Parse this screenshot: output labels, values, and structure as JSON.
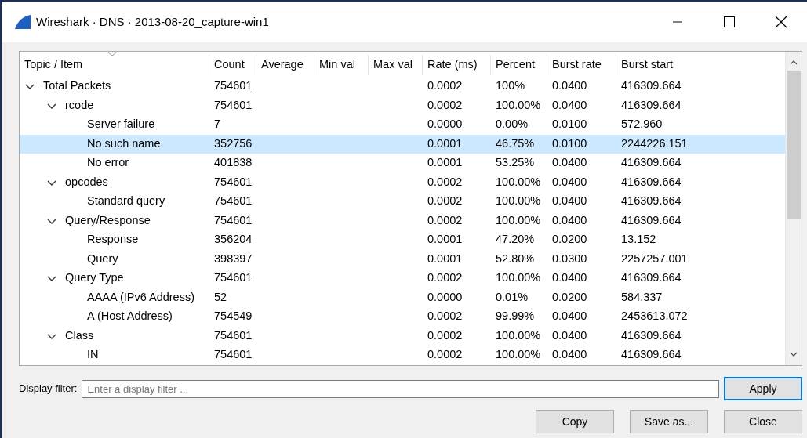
{
  "window": {
    "title": "Wireshark · DNS · 2013-08-20_capture-win1"
  },
  "table": {
    "columns": [
      "Topic / Item",
      "Count",
      "Average",
      "Min val",
      "Max val",
      "Rate (ms)",
      "Percent",
      "Burst rate",
      "Burst start"
    ],
    "rows": [
      {
        "topic": "Total Packets",
        "count": "754601",
        "rate": "0.0002",
        "percent": "100%",
        "burst_rate": "0.0400",
        "burst_start": "416309.664",
        "expanded": true,
        "selected": false,
        "children": [
          {
            "topic": "rcode",
            "count": "754601",
            "rate": "0.0002",
            "percent": "100.00%",
            "burst_rate": "0.0400",
            "burst_start": "416309.664",
            "expanded": true,
            "selected": false,
            "children": [
              {
                "topic": "Server failure",
                "count": "7",
                "rate": "0.0000",
                "percent": "0.00%",
                "burst_rate": "0.0100",
                "burst_start": "572.960",
                "selected": false
              },
              {
                "topic": "No such name",
                "count": "352756",
                "rate": "0.0001",
                "percent": "46.75%",
                "burst_rate": "0.0100",
                "burst_start": "2244226.151",
                "selected": true
              },
              {
                "topic": "No error",
                "count": "401838",
                "rate": "0.0001",
                "percent": "53.25%",
                "burst_rate": "0.0400",
                "burst_start": "416309.664",
                "selected": false
              }
            ]
          },
          {
            "topic": "opcodes",
            "count": "754601",
            "rate": "0.0002",
            "percent": "100.00%",
            "burst_rate": "0.0400",
            "burst_start": "416309.664",
            "expanded": true,
            "selected": false,
            "children": [
              {
                "topic": "Standard query",
                "count": "754601",
                "rate": "0.0002",
                "percent": "100.00%",
                "burst_rate": "0.0400",
                "burst_start": "416309.664",
                "selected": false
              }
            ]
          },
          {
            "topic": "Query/Response",
            "count": "754601",
            "rate": "0.0002",
            "percent": "100.00%",
            "burst_rate": "0.0400",
            "burst_start": "416309.664",
            "expanded": true,
            "selected": false,
            "children": [
              {
                "topic": "Response",
                "count": "356204",
                "rate": "0.0001",
                "percent": "47.20%",
                "burst_rate": "0.0200",
                "burst_start": "13.152",
                "selected": false
              },
              {
                "topic": "Query",
                "count": "398397",
                "rate": "0.0001",
                "percent": "52.80%",
                "burst_rate": "0.0300",
                "burst_start": "2257257.001",
                "selected": false
              }
            ]
          },
          {
            "topic": "Query Type",
            "count": "754601",
            "rate": "0.0002",
            "percent": "100.00%",
            "burst_rate": "0.0400",
            "burst_start": "416309.664",
            "expanded": true,
            "selected": false,
            "children": [
              {
                "topic": "AAAA (IPv6 Address)",
                "count": "52",
                "rate": "0.0000",
                "percent": "0.01%",
                "burst_rate": "0.0200",
                "burst_start": "584.337",
                "selected": false
              },
              {
                "topic": "A (Host Address)",
                "count": "754549",
                "rate": "0.0002",
                "percent": "99.99%",
                "burst_rate": "0.0400",
                "burst_start": "2453613.072",
                "selected": false
              }
            ]
          },
          {
            "topic": "Class",
            "count": "754601",
            "rate": "0.0002",
            "percent": "100.00%",
            "burst_rate": "0.0400",
            "burst_start": "416309.664",
            "expanded": true,
            "selected": false,
            "children": [
              {
                "topic": "IN",
                "count": "754601",
                "rate": "0.0002",
                "percent": "100.00%",
                "burst_rate": "0.0400",
                "burst_start": "416309.664",
                "selected": false
              }
            ]
          }
        ]
      }
    ]
  },
  "display_filter": {
    "label": "Display filter:",
    "placeholder": "Enter a display filter ..."
  },
  "buttons": [
    {
      "label": "Apply",
      "kind": "apply"
    },
    {
      "label": "Copy",
      "kind": "action"
    },
    {
      "label": "Save as...",
      "kind": "action"
    },
    {
      "label": "Close",
      "kind": "action"
    }
  ]
}
